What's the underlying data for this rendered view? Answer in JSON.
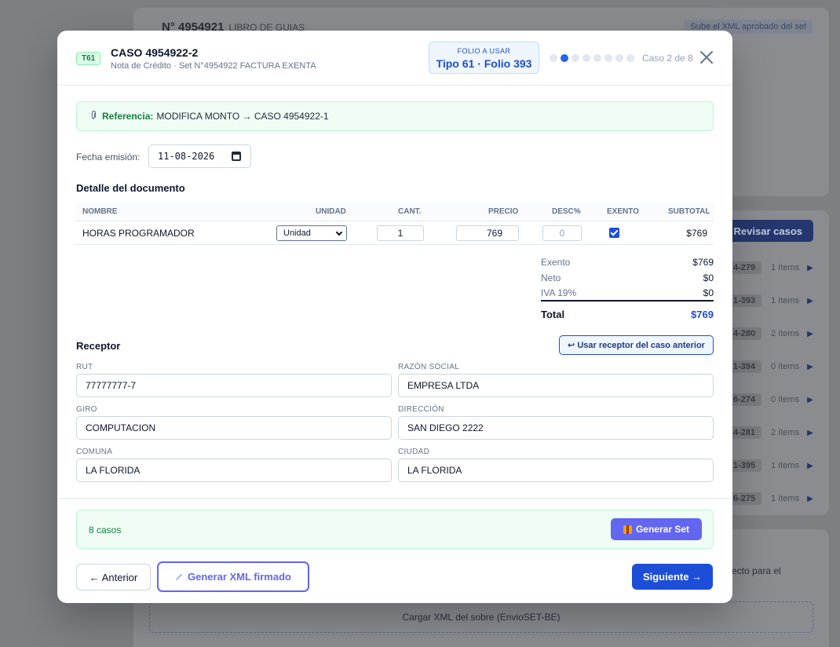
{
  "background": {
    "title_number": "N° 4954921",
    "title_text": "LIBRO DE GUIAS",
    "hint": "Sube el XML aprobado del set",
    "review_button": "Revisar casos",
    "rows": [
      {
        "code": "4-279",
        "items": "1 ítems"
      },
      {
        "code": "1-393",
        "items": "1 ítems"
      },
      {
        "code": "4-280",
        "items": "2 ítems"
      },
      {
        "code": "1-394",
        "items": "0 ítems"
      },
      {
        "code": "6-274",
        "items": "0 ítems"
      },
      {
        "code": "4-281",
        "items": "2 ítems"
      },
      {
        "code": "1-395",
        "items": "1 ítems"
      },
      {
        "code": "6-275",
        "items": "1 ítems"
      }
    ],
    "side_text": "ecto para el",
    "upload_label": "Cargar XML del sobre (EnvioSET-BE)"
  },
  "modal": {
    "type_badge": "T61",
    "case_title": "CASO 4954922-2",
    "case_subtitle": "Nota de Crédito · Set N°4954922 FACTURA EXENTA",
    "folio_label": "FOLIO A USAR",
    "folio_value": "Tipo 61 · Folio 393",
    "progress": {
      "current": 2,
      "total": 8
    },
    "case_count": "Caso 2 de 8",
    "reference_label": "Referencia:",
    "reference_text": "MODIFICA MONTO → CASO 4954922-1",
    "fecha_label": "Fecha emisión:",
    "fecha_value": "11-08-2026",
    "detail_title": "Detalle del documento",
    "columns": [
      "NOMBRE",
      "UNIDAD",
      "CANT.",
      "PRECIO",
      "DESC%",
      "EXENTO",
      "SUBTOTAL"
    ],
    "line_item": {
      "nombre": "HORAS PROGRAMADOR",
      "unidad": "Unidad",
      "cantidad": "1",
      "precio": "769",
      "descuento": "0",
      "exento": true,
      "subtotal": "$769"
    },
    "totals": {
      "exento_label": "Exento",
      "exento_value": "$769",
      "neto_label": "Neto",
      "neto_value": "$0",
      "iva_label": "IVA 19%",
      "iva_value": "$0",
      "total_label": "Total",
      "total_value": "$769"
    },
    "receptor_title": "Receptor",
    "use_prev_button": "↩ Usar receptor del caso anterior",
    "receptor": {
      "rut_label": "RUT",
      "rut": "77777777-7",
      "razon_label": "RAZÓN SOCIAL",
      "razon": "EMPRESA LTDA",
      "giro_label": "GIRO",
      "giro": "COMPUTACION",
      "direccion_label": "DIRECCIÓN",
      "direccion": "SAN DIEGO 2222",
      "comuna_label": "COMUNA",
      "comuna": "LA FLORIDA",
      "ciudad_label": "CIUDAD",
      "ciudad": "LA FLORIDA"
    },
    "sets_count": "8 casos",
    "generate_set_button": "Generar Set",
    "prev_button": "← Anterior",
    "xml_button": "Generar XML firmado",
    "next_button": "Siguiente →"
  },
  "colors": {
    "primary": "#1d4ed8",
    "indigo": "#6366f1",
    "success": "#15803d"
  }
}
